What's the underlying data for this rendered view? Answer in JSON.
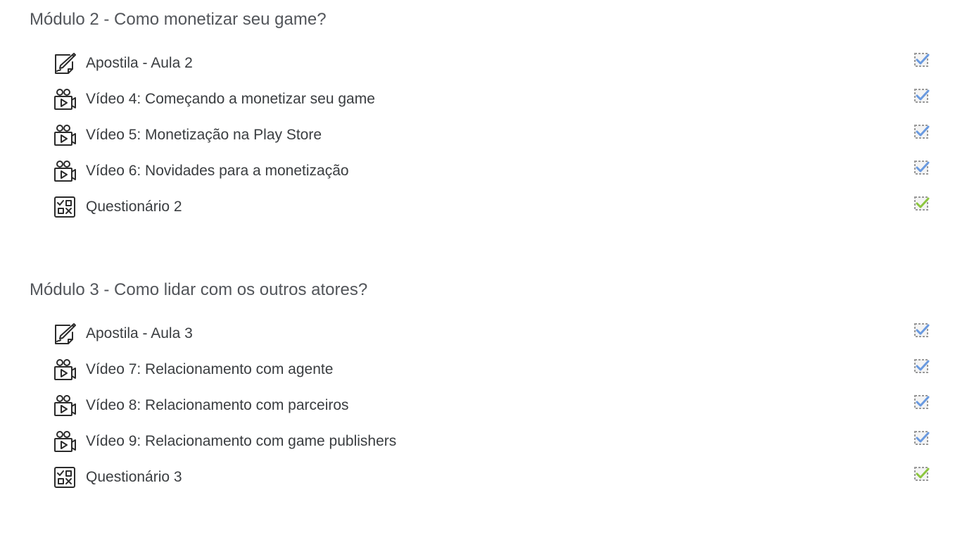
{
  "sections": [
    {
      "title": "Módulo 2 - Como monetizar seu game?",
      "activities": [
        {
          "icon": "assignment-pencil-icon",
          "name": "Apostila - Aula 2",
          "completion": "completed-manual",
          "check_color": "#6a9ae0"
        },
        {
          "icon": "video-camera-icon",
          "name": "Vídeo 4: Começando a monetizar seu game",
          "completion": "completed-manual",
          "check_color": "#6a9ae0"
        },
        {
          "icon": "video-camera-icon",
          "name": "Vídeo 5: Monetização na Play Store",
          "completion": "completed-manual",
          "check_color": "#6a9ae0"
        },
        {
          "icon": "video-camera-icon",
          "name": "Vídeo 6: Novidades para a monetização",
          "completion": "completed-manual",
          "check_color": "#6a9ae0"
        },
        {
          "icon": "quiz-icon",
          "name": "Questionário 2",
          "completion": "completed-auto",
          "check_color": "#8cc63f"
        }
      ]
    },
    {
      "title": "Módulo 3 - Como lidar com os outros atores?",
      "activities": [
        {
          "icon": "assignment-pencil-icon",
          "name": "Apostila - Aula 3",
          "completion": "completed-manual",
          "check_color": "#6a9ae0"
        },
        {
          "icon": "video-camera-icon",
          "name": "Vídeo 7: Relacionamento com agente",
          "completion": "completed-manual",
          "check_color": "#6a9ae0"
        },
        {
          "icon": "video-camera-icon",
          "name": "Vídeo 8: Relacionamento com parceiros",
          "completion": "completed-manual",
          "check_color": "#6a9ae0"
        },
        {
          "icon": "video-camera-icon",
          "name": "Vídeo 9: Relacionamento com game publishers",
          "completion": "completed-manual",
          "check_color": "#6a9ae0"
        },
        {
          "icon": "quiz-icon",
          "name": "Questionário 3",
          "completion": "completed-auto",
          "check_color": "#8cc63f"
        }
      ]
    }
  ],
  "colors": {
    "heading": "#52555a",
    "text": "#3a3d40",
    "checkbox_border": "#9a9a9a",
    "check_manual": "#6a9ae0",
    "check_auto": "#8cc63f"
  }
}
